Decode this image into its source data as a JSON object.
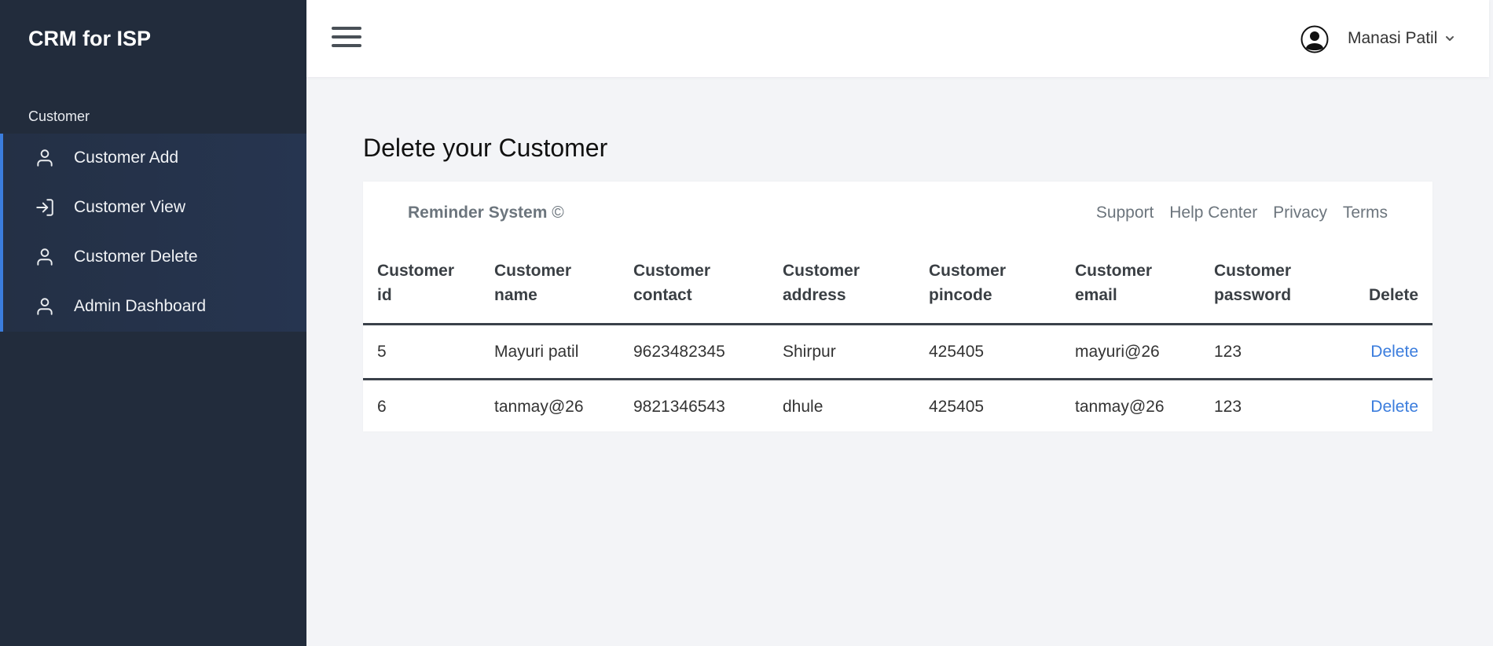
{
  "sidebar": {
    "brand": "CRM for ISP",
    "section": "Customer",
    "items": [
      {
        "label": "Customer Add",
        "icon": "user-icon"
      },
      {
        "label": "Customer View",
        "icon": "sign-in-icon"
      },
      {
        "label": "Customer Delete",
        "icon": "user-icon"
      },
      {
        "label": "Admin Dashboard",
        "icon": "user-icon"
      }
    ],
    "accent": "#3b7ddd"
  },
  "topbar": {
    "menu_icon": "hamburger-menu-icon",
    "user_name": "Manasi Patil",
    "avatar_icon": "user-circle-icon",
    "caret_icon": "chevron-down-icon"
  },
  "main": {
    "title": "Delete your Customer",
    "card": {
      "footer_brand": "Reminder System",
      "footer_copy": "©",
      "links": [
        "Support",
        "Help Center",
        "Privacy",
        "Terms"
      ]
    },
    "table": {
      "headers": [
        [
          "Customer",
          "id"
        ],
        [
          "Customer",
          "name"
        ],
        [
          "Customer",
          "contact"
        ],
        [
          "Customer",
          "address"
        ],
        [
          "Customer",
          "pincode"
        ],
        [
          "Customer",
          "email"
        ],
        [
          "Customer",
          "password"
        ],
        [
          "Delete"
        ]
      ],
      "rows": [
        {
          "id": "5",
          "name": "Mayuri patil",
          "contact": "9623482345",
          "address": "Shirpur",
          "pincode": "425405",
          "email": "mayuri@26",
          "password": "123",
          "action": "Delete"
        },
        {
          "id": "6",
          "name": "tanmay@26",
          "contact": "9821346543",
          "address": "dhule",
          "pincode": "425405",
          "email": "tanmay@26",
          "password": "123",
          "action": "Delete"
        }
      ]
    }
  },
  "colors": {
    "sidebar_bg": "#222c3c",
    "link": "#3b7ddd",
    "page_bg": "#f3f4f7"
  }
}
